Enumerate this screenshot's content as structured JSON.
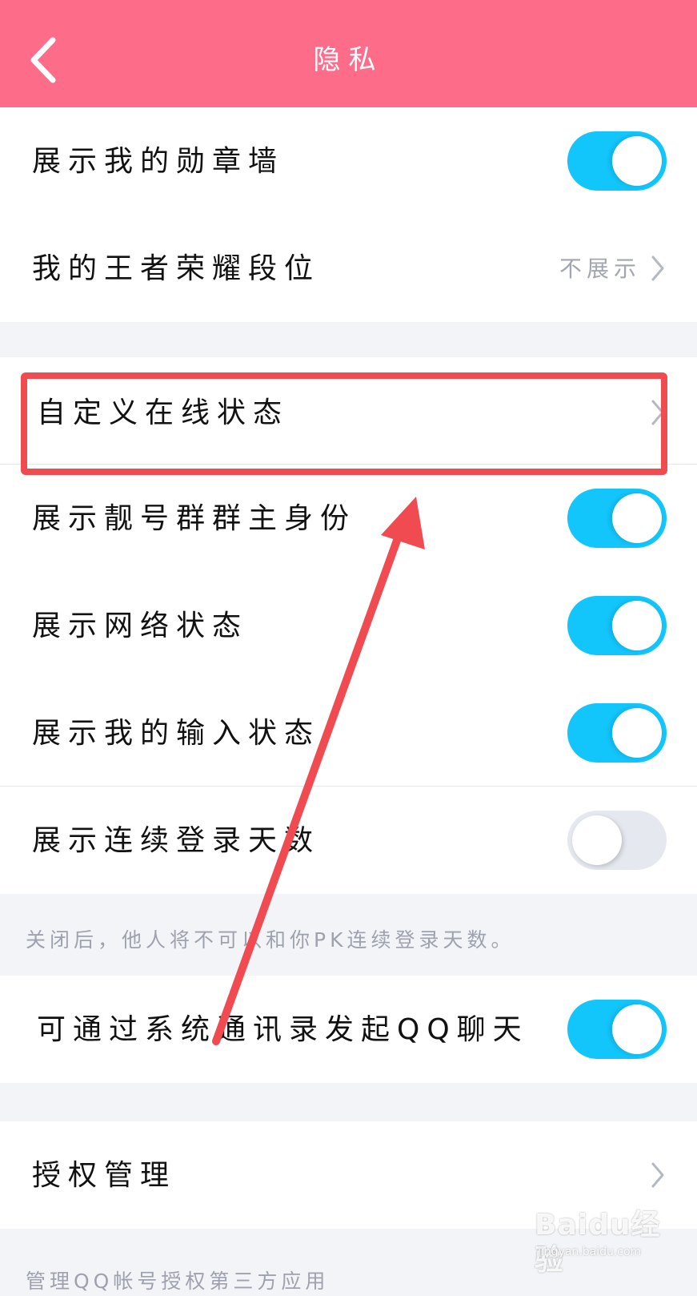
{
  "header": {
    "title": "隐私",
    "back_icon": "chevron-left-icon",
    "background": "#fd6d8a"
  },
  "rows": {
    "badge_wall": {
      "label": "展示我的勋章墙",
      "toggle": "on"
    },
    "honor_rank": {
      "label": "我的王者荣耀段位",
      "value": "不展示"
    },
    "custom_status": {
      "label": "自定义在线状态"
    },
    "group_owner": {
      "label": "展示靓号群群主身份",
      "toggle": "on"
    },
    "network_status": {
      "label": "展示网络状态",
      "toggle": "on"
    },
    "input_status": {
      "label": "展示我的输入状态",
      "toggle": "on"
    },
    "login_days": {
      "label": "展示连续登录天数",
      "toggle": "off"
    },
    "system_contacts": {
      "label": "可通过系统通讯录发起QQ聊天",
      "toggle": "on"
    },
    "authorization": {
      "label": "授权管理"
    }
  },
  "notes": {
    "login_days_note": "关闭后，他人将不可以和你PK连续登录天数。",
    "bottom_note": "管理QQ帐号授权第三方应用"
  },
  "watermark": {
    "brand": "Baidu经验",
    "url": "jingyan.baidu.com"
  },
  "colors": {
    "toggle_on": "#12c5fb",
    "toggle_off": "#e6e8f0",
    "highlight": "#ef4b50"
  }
}
